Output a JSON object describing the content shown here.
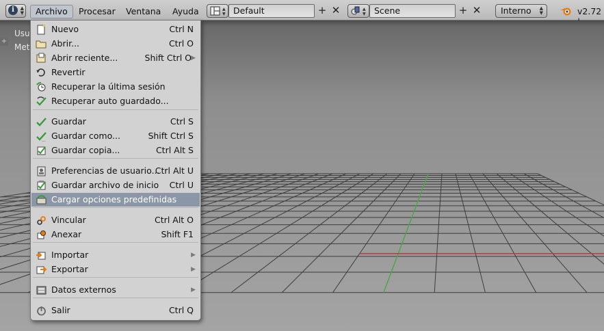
{
  "header": {
    "menus": [
      "Archivo",
      "Procesar",
      "Ventana",
      "Ayuda"
    ],
    "layout_field": "Default",
    "scene_field": "Scene",
    "render_engine": "Interno",
    "version": "v2.72 |"
  },
  "viewport": {
    "overlay_line1": "Usu",
    "overlay_line2": "Met"
  },
  "file_menu": {
    "items": [
      {
        "label": "Nuevo",
        "shortcut": "Ctrl N",
        "icon": "new-file-icon"
      },
      {
        "label": "Abrir...",
        "shortcut": "Ctrl O",
        "icon": "open-folder-icon"
      },
      {
        "label": "Abrir reciente...",
        "shortcut": "Shift Ctrl O",
        "icon": "recent-files-icon",
        "submenu": true
      },
      {
        "label": "Revertir",
        "shortcut": "",
        "icon": "revert-icon"
      },
      {
        "label": "Recuperar la última sesión",
        "shortcut": "",
        "icon": "recover-session-icon"
      },
      {
        "label": "Recuperar auto guardado...",
        "shortcut": "",
        "icon": "recover-autosave-icon"
      },
      {
        "label": "Guardar",
        "shortcut": "Ctrl S",
        "icon": "save-check-icon"
      },
      {
        "label": "Guardar como...",
        "shortcut": "Shift Ctrl S",
        "icon": "save-as-icon"
      },
      {
        "label": "Guardar copia...",
        "shortcut": "Ctrl Alt S",
        "icon": "save-copy-icon"
      },
      {
        "label": "Preferencias de usuario...",
        "shortcut": "Ctrl Alt U",
        "icon": "preferences-icon"
      },
      {
        "label": "Guardar archivo de inicio",
        "shortcut": "Ctrl U",
        "icon": "save-startup-icon"
      },
      {
        "label": "Cargar opciones predefinidas",
        "shortcut": "",
        "icon": "load-factory-icon"
      },
      {
        "label": "Vincular",
        "shortcut": "Ctrl Alt O",
        "icon": "link-icon"
      },
      {
        "label": "Anexar",
        "shortcut": "Shift F1",
        "icon": "append-icon"
      },
      {
        "label": "Importar",
        "shortcut": "",
        "icon": "import-icon",
        "submenu": true
      },
      {
        "label": "Exportar",
        "shortcut": "",
        "icon": "export-icon",
        "submenu": true
      },
      {
        "label": "Datos externos",
        "shortcut": "",
        "icon": "external-data-icon",
        "submenu": true
      },
      {
        "label": "Salir",
        "shortcut": "Ctrl Q",
        "icon": "quit-icon"
      }
    ],
    "highlighted_index": 11
  },
  "colors": {
    "menu_bg": "#d2d2d2",
    "highlight": "#8b96a6",
    "grid_line": "#3c3c3c",
    "axis_x": "#b33a3a",
    "axis_y": "#4aa84a"
  }
}
